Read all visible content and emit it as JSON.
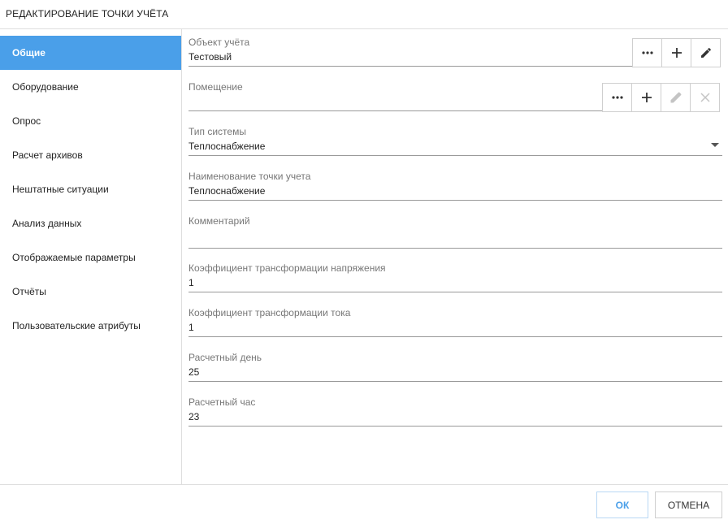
{
  "dialog": {
    "title": "РЕДАКТИРОВАНИЕ ТОЧКИ УЧЁТА"
  },
  "sidebar": {
    "items": [
      {
        "label": "Общие",
        "active": true
      },
      {
        "label": "Оборудование"
      },
      {
        "label": "Опрос"
      },
      {
        "label": "Расчет архивов"
      },
      {
        "label": "Нештатные ситуации"
      },
      {
        "label": "Анализ данных"
      },
      {
        "label": "Отображаемые параметры"
      },
      {
        "label": "Отчёты"
      },
      {
        "label": "Пользовательские атрибуты"
      }
    ]
  },
  "form": {
    "object": {
      "label": "Объект учёта",
      "value": "Тестовый"
    },
    "room": {
      "label": "Помещение",
      "value": ""
    },
    "system_type": {
      "label": "Тип системы",
      "value": "Теплоснабжение"
    },
    "point_name": {
      "label": "Наименование точки учета",
      "value": "Теплоснабжение"
    },
    "comment": {
      "label": "Комментарий",
      "value": ""
    },
    "voltage_coef": {
      "label": "Коэффициент трансформации напряжения",
      "value": "1"
    },
    "current_coef": {
      "label": "Коэффициент трансформации тока",
      "value": "1"
    },
    "calc_day": {
      "label": "Расчетный день",
      "value": "25"
    },
    "calc_hour": {
      "label": "Расчетный час",
      "value": "23"
    }
  },
  "buttons": {
    "ok": "ОК",
    "cancel": "ОТМЕНА"
  },
  "colors": {
    "accent": "#4a9fe9"
  },
  "icons": [
    "ellipsis-icon",
    "plus-icon",
    "pencil-icon",
    "close-icon",
    "chevron-down-icon"
  ]
}
